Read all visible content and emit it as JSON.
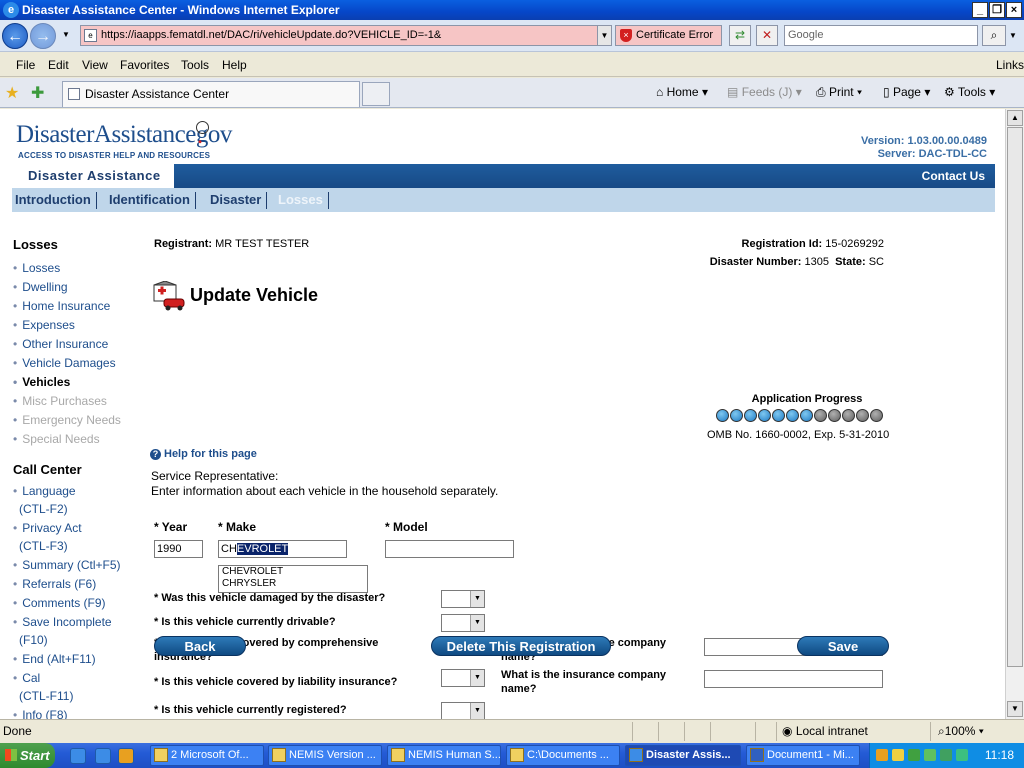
{
  "browser": {
    "window_title": "Disaster Assistance Center - Windows Internet Explorer",
    "url": "https://iaapps.fematdl.net/DAC/ri/vehicleUpdate.do?VEHICLE_ID=-1&",
    "cert_error": "Certificate Error",
    "search_placeholder": "Google",
    "menu": [
      "File",
      "Edit",
      "View",
      "Favorites",
      "Tools",
      "Help"
    ],
    "links": "Links",
    "tab_title": "Disaster Assistance Center",
    "commands": {
      "home": "Home",
      "feeds": "Feeds (J)",
      "print": "Print",
      "page": "Page",
      "tools": "Tools"
    }
  },
  "site": {
    "logo_main": "DisasterAssistance",
    "logo_dot": ".",
    "logo_gov": "gov",
    "tagline": "ACCESS TO DISASTER HELP AND RESOURCES",
    "version": "Version: 1.03.00.00.0489",
    "server": "Server: DAC-TDL-CC",
    "section_title": "Disaster Assistance",
    "contact": "Contact Us",
    "tabs": [
      "Introduction",
      "Identification",
      "Disaster",
      "Losses"
    ]
  },
  "sidebar": {
    "losses_heading": "Losses",
    "losses_items": [
      "Losses",
      "Dwelling",
      "Home Insurance",
      "Expenses",
      "Other Insurance",
      "Vehicle Damages",
      "Vehicles",
      "Misc Purchases",
      "Emergency Needs",
      "Special Needs"
    ],
    "callcenter_heading": "Call Center",
    "callcenter_items": [
      {
        "line1": "Language",
        "line2": "(CTL-F2)"
      },
      {
        "line1": "Privacy Act",
        "line2": "(CTL-F3)"
      },
      {
        "line1": "Summary (Ctl+F5)",
        "line2": ""
      },
      {
        "line1": "Referrals (F6)",
        "line2": ""
      },
      {
        "line1": "Comments (F9)",
        "line2": ""
      },
      {
        "line1": "Save Incomplete",
        "line2": "(F10)"
      },
      {
        "line1": "End (Alt+F11)",
        "line2": ""
      },
      {
        "line1": "Cal",
        "line2": "(CTL-F11)"
      },
      {
        "line1": "Info (F8)",
        "line2": ""
      }
    ]
  },
  "main": {
    "registrant_label": "Registrant:",
    "registrant_value": "MR TEST TESTER",
    "regid_label": "Registration Id:",
    "regid_value": "15-0269292",
    "disaster_label": "Disaster Number:",
    "disaster_value": "1305",
    "state_label": "State:",
    "state_value": "SC",
    "title": "Update Vehicle",
    "progress_label": "Application Progress",
    "progress_completed": 7,
    "progress_total": 12,
    "omb": "OMB No. 1660-0002, Exp. 5-31-2010",
    "help": "Help for this page",
    "service_rep": "Service Representative:",
    "instruction": "Enter information about each vehicle in the household separately.",
    "year_label": "* Year",
    "make_label": "* Make",
    "model_label": "* Model",
    "year_value": "1990",
    "make_typed": "CH",
    "make_autocomplete": "EVROLET",
    "model_value": "",
    "suggestions": [
      "CHEVROLET",
      "CHRYSLER"
    ],
    "q_damaged": "* Was this vehicle damaged by the disaster?",
    "q_drivable": "* Is this vehicle currently drivable?",
    "q_comprehensive_1": "* Is this vehicle covered by comprehensive",
    "q_comprehensive_2": "insurance?",
    "q_liability": "* Is this vehicle covered by liability insurance?",
    "q_registered": "* Is this vehicle currently registered?",
    "insurer_q1": "What is the insurance company",
    "insurer_q2": "name?",
    "back_label": "Back",
    "delete_label": "Delete This Registration",
    "save_label": "Save"
  },
  "status": {
    "text": "Done",
    "zone": "Local intranet",
    "zoom": "100%"
  },
  "taskbar": {
    "start": "Start",
    "buttons": [
      "2 Microsoft Of...",
      "NEMIS Version ...",
      "NEMIS Human S...",
      "C:\\Documents ...",
      "Disaster Assis...",
      "Document1 - Mi..."
    ],
    "clock": "11:18"
  }
}
